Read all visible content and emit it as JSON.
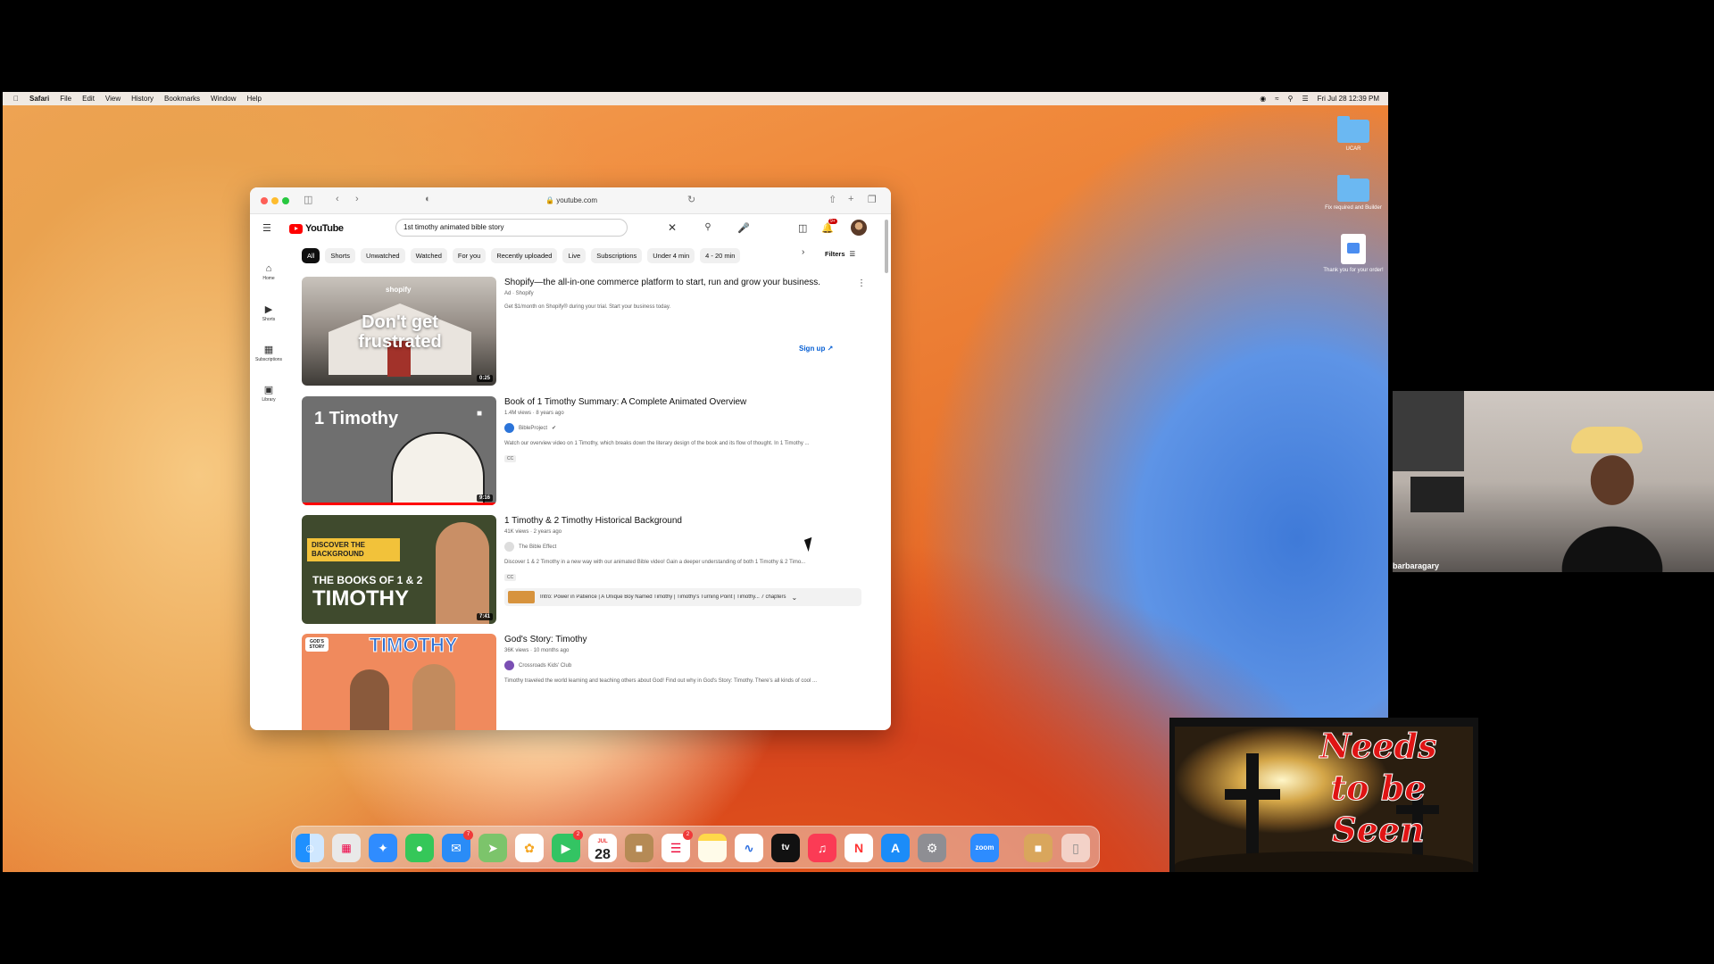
{
  "menubar": {
    "app": "Safari",
    "items": [
      "File",
      "Edit",
      "View",
      "History",
      "Bookmarks",
      "Window",
      "Help"
    ],
    "clock": "Fri Jul 28  12:39 PM"
  },
  "desktop_icons": [
    {
      "label": "UCAR"
    },
    {
      "label": "Fix required and Builder"
    },
    {
      "label": "Thank you for your order!"
    }
  ],
  "safari": {
    "url": "youtube.com"
  },
  "youtube": {
    "logo": "YouTube",
    "search_value": "1st timothy animated bible story",
    "notif_count": "9+",
    "chips": [
      "All",
      "Shorts",
      "Unwatched",
      "Watched",
      "For you",
      "Recently uploaded",
      "Live",
      "Subscriptions",
      "Under 4 min",
      "4 - 20 min"
    ],
    "filters": "Filters",
    "nav": [
      {
        "label": "Home",
        "icon": "home-icon"
      },
      {
        "label": "Shorts",
        "icon": "shorts-icon"
      },
      {
        "label": "Subscriptions",
        "icon": "subscriptions-icon"
      },
      {
        "label": "Library",
        "icon": "library-icon"
      }
    ],
    "results": [
      {
        "title": "Shopify—the all-in-one commerce platform to start, run and grow your business.",
        "meta": "Ad · Shopify",
        "desc": "Get $1/month on Shopify® during your trial. Start your business today.",
        "cta": "Sign up",
        "thumb_text": "Don't get frustrated",
        "thumb_brand": "shopify",
        "duration": "0:25"
      },
      {
        "title": "Book of 1 Timothy Summary: A Complete Animated Overview",
        "meta": "1.4M views · 8 years ago",
        "channel": "BibleProject",
        "desc": "Watch our overview video on 1 Timothy, which breaks down the literary design of the book and its flow of thought. In 1 Timothy ...",
        "cc": "CC",
        "thumb_text": "1 Timothy",
        "duration": "9:16"
      },
      {
        "title": "1 Timothy & 2 Timothy Historical Background",
        "meta": "41K views · 2 years ago",
        "channel": "The Bible Effect",
        "desc": "Discover 1 & 2 Timothy in a new way with our animated Bible video! Gain a deeper understanding of both 1 Timothy & 2 Timo...",
        "cc": "CC",
        "chapters": "Intro: Power in Patience | A Unique Boy Named Timothy | Timothy's Turning Point | Timothy... 7 chapters",
        "thumb_top": "DISCOVER THE BACKGROUND",
        "thumb_mid": "THE BOOKS OF 1 & 2",
        "thumb_bottom": "TIMOTHY",
        "duration": "7:41"
      },
      {
        "title": "God's Story: Timothy",
        "meta": "36K views · 10 months ago",
        "channel": "Crossroads Kids' Club",
        "desc": "Timothy traveled the world learning and teaching others about God! Find out why in God's Story: Timothy. There's all kinds of cool ...",
        "thumb_text": "TIMOTHY",
        "thumb_badge": "GOD'S STORY"
      }
    ]
  },
  "dock": {
    "calendar_month": "JUL",
    "calendar_day": "28",
    "mail_badge": "7",
    "facetime_badge": "2",
    "reminders_badge": "2",
    "tv_label": "tv",
    "zoom_label": "zoom"
  },
  "webcam": {
    "name": "barbaragary"
  },
  "promo": {
    "line1": "Needs",
    "line2": "to be",
    "line3": "Seen"
  },
  "colors": {
    "youtube_red": "#ff0000",
    "chip_active": "#0f0f0f",
    "promo_text": "#e01414"
  }
}
